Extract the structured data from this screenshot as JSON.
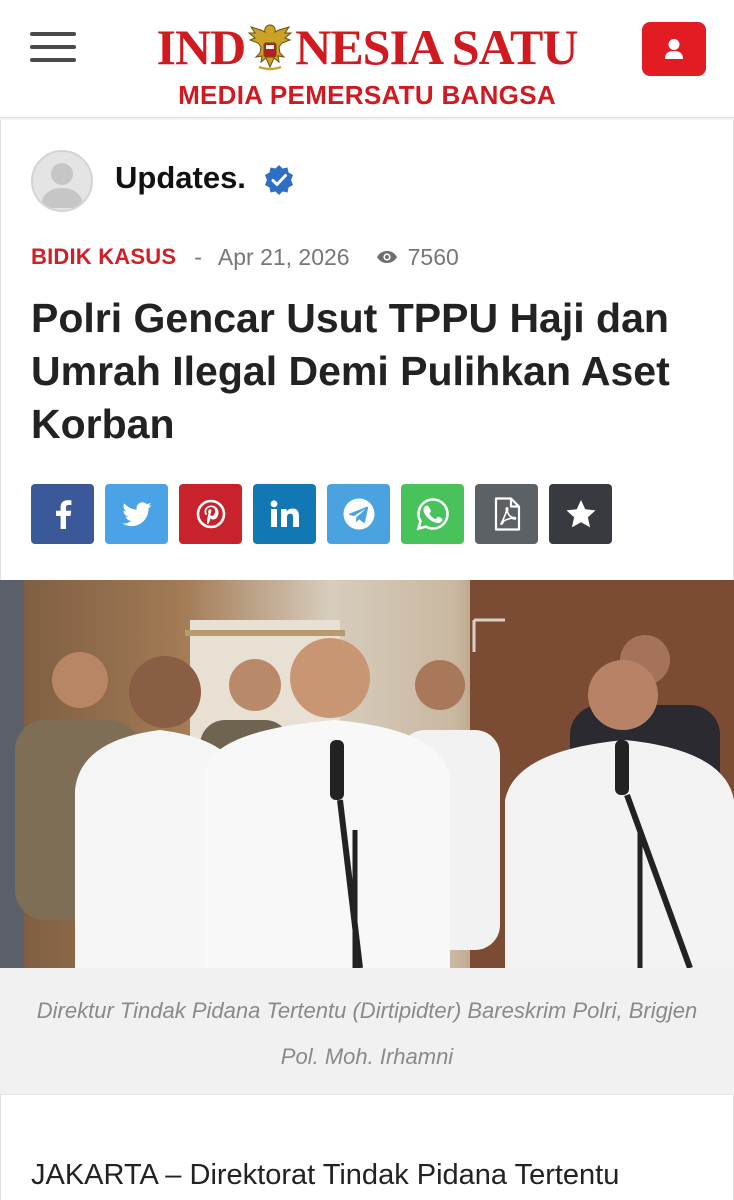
{
  "header": {
    "logo_left": "IND",
    "logo_right": "NESIA SATU",
    "tagline": "MEDIA PEMERSATU BANGSA",
    "menu_icon": "hamburger-menu-icon",
    "user_icon": "user-icon",
    "brand_color": "#d01a20"
  },
  "article": {
    "author": "Updates.",
    "category": "BIDIK KASUS",
    "separator": "-",
    "date": "Apr 21, 2026",
    "views": "7560",
    "title": "Polri Gencar Usut TPPU Haji dan Umrah Ilegal Demi Pulihkan Aset Korban",
    "share_buttons": [
      {
        "name": "facebook",
        "icon": "facebook-icon",
        "color": "#3b5998"
      },
      {
        "name": "twitter",
        "icon": "twitter-icon",
        "color": "#4aa3e6"
      },
      {
        "name": "pinterest",
        "icon": "pinterest-icon",
        "color": "#c8232c"
      },
      {
        "name": "linkedin",
        "icon": "linkedin-icon",
        "color": "#1178b3"
      },
      {
        "name": "telegram",
        "icon": "telegram-icon",
        "color": "#4aa3e0"
      },
      {
        "name": "whatsapp",
        "icon": "whatsapp-icon",
        "color": "#48c35b"
      },
      {
        "name": "pdf",
        "icon": "pdf-icon",
        "color": "#5c6166"
      },
      {
        "name": "favorite",
        "icon": "star-icon",
        "color": "#373b3f"
      }
    ],
    "caption": "Direktur Tindak Pidana Tertentu (Dirtipidter) Bareskrim Polri, Brigjen Pol. Moh. Irhamni",
    "body_lead": "JAKARTA – Direktorat Tindak Pidana Tertentu (Dirtipidter) Bareskrim Polri telah melakukan"
  }
}
